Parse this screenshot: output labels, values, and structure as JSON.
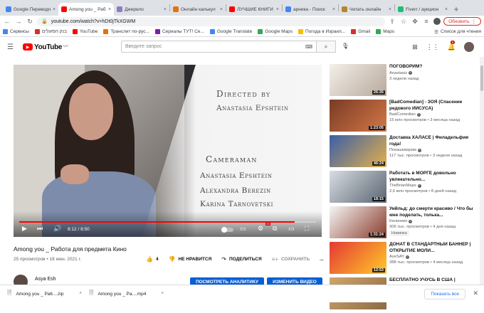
{
  "browser": {
    "tabs": [
      {
        "label": "Google Переводч",
        "color": "#4285f4",
        "active": false
      },
      {
        "label": "Among you _ Раб",
        "color": "#ff0000",
        "active": true
      },
      {
        "label": "Джерело",
        "color": "#8e7cc3",
        "active": false
      },
      {
        "label": "Онлайн калькул",
        "color": "#e8710a",
        "active": false
      },
      {
        "label": "ЛУЧШИЕ КНИГИ",
        "color": "#ff0000",
        "active": false
      },
      {
        "label": "арника - Поиск",
        "color": "#4285f4",
        "active": false
      },
      {
        "label": "Читать онлайн",
        "color": "#b5862a",
        "active": false
      },
      {
        "label": "Fiverr / аукцион",
        "color": "#1dbf73",
        "active": false
      }
    ],
    "url": "youtube.com/watch?v=hDt0jTkXGWM",
    "update_label": "Обновить",
    "bookmarks": [
      {
        "label": "Сервисы",
        "color": "#4285f4"
      },
      {
        "label": "בנק הפועלים",
        "color": "#d93025"
      },
      {
        "label": "YouTube",
        "color": "#ff0000"
      },
      {
        "label": "Транслит по-рус...",
        "color": "#e8710a"
      },
      {
        "label": "Сериалы ТУТ! Се...",
        "color": "#7b1fa2"
      },
      {
        "label": "Google Translate",
        "color": "#4285f4"
      },
      {
        "label": "Google Maps",
        "color": "#34a853"
      },
      {
        "label": "Погода в Израил...",
        "color": "#fbbc04"
      },
      {
        "label": "Gmail",
        "color": "#d93025"
      },
      {
        "label": "Maps",
        "color": "#34a853"
      }
    ],
    "reading_list": "Список для чтения"
  },
  "youtube": {
    "logo_text": "YouTube",
    "logo_country": "UA",
    "search_placeholder": "Введите запрос",
    "notification_count": "9"
  },
  "player": {
    "credit_director_title": "Directed by",
    "credit_director_name": "Anastasia Epshtein",
    "credit_camera_title": "Cameraman",
    "credit_camera_names": [
      "Anastasia Epshtein",
      "Alexandra Berezin",
      "Karina Tarnovetski"
    ],
    "time": "8:12 / 8:50",
    "progress": 0.928
  },
  "video": {
    "title": "Among you _ Работа для предмета Кино",
    "meta": "25 просмотров • 18 июн. 2021 г.",
    "likes": "4",
    "dislike_label": "НЕ НРАВИТСЯ",
    "share_label": "ПОДЕЛИТЬСЯ",
    "save_label": "СОХРАНИТЬ",
    "more": "...",
    "channel": "Asya Esh",
    "analytics_label": "ПОСМОТРЕТЬ АНАЛИТИКУ",
    "edit_label": "ИЗМЕНИТЬ ВИДЕО"
  },
  "recommendations": [
    {
      "title": "ПОГОВОРИМ?",
      "channel": "Anastasiz",
      "verified": true,
      "meta": "3 недели назад",
      "duration": "26:26",
      "colors": [
        "#f2efe9",
        "#b9a89a"
      ]
    },
    {
      "title": "[BadComedian] - ЗОЯ (Спасение редового ИИСУСА)",
      "channel": "BadComedian",
      "verified": true,
      "meta2": "15 млн просмотров •",
      "meta": "3 месяца назад",
      "duration": "1:23:05",
      "colors": [
        "#7a3b25",
        "#d37846"
      ]
    },
    {
      "title": "Доставка ХАЛАСЁ | Филадельфия года!",
      "channel": "Покашеварим",
      "verified": true,
      "meta2": "117 тыс. просмотров •",
      "meta": "3 недели назад",
      "duration": "46:24",
      "colors": [
        "#3a5fa8",
        "#e3b04b"
      ]
    },
    {
      "title": "Работать в МОРГЕ довольно увлекательно...",
      "channel": "TheBrianMaps",
      "verified": true,
      "meta2": "2,6 млн просмотров •",
      "meta": "8 дней назад",
      "duration": "18:15",
      "colors": [
        "#d8dde2",
        "#5a6672"
      ]
    },
    {
      "title": "Уийльд: до смерти красиво / Что бы мне поделать, толька...",
      "channel": "Калинкин",
      "verified": true,
      "meta2": "306 тыс. просмотров •",
      "meta": "4 дня назад",
      "duration": "1:31:24",
      "badge": "Новинка",
      "colors": [
        "#f5f5f5",
        "#8a3a2a"
      ]
    },
    {
      "title": "ДОНАТ В СТАНДАРТНЫЙ БАННЕР | ОТКРЫТИЕ МОЛИ...",
      "channel": "AxeSAY",
      "verified": true,
      "meta2": "388 тыс. просмотров •",
      "meta": "4 месяца назад",
      "duration": "12:53",
      "colors": [
        "#e53935",
        "#ffca28"
      ]
    },
    {
      "title": "БЕСПЛАТНО УЧУСЬ В США |",
      "channel": "",
      "meta": "",
      "duration": "",
      "colors": [
        "#cfa56d",
        "#8d6b44"
      ]
    }
  ],
  "downloads": {
    "items": [
      "Among you _ Ра6....zip",
      "Among you _ Pa....mp4"
    ],
    "show_all_label": "Показать все"
  }
}
